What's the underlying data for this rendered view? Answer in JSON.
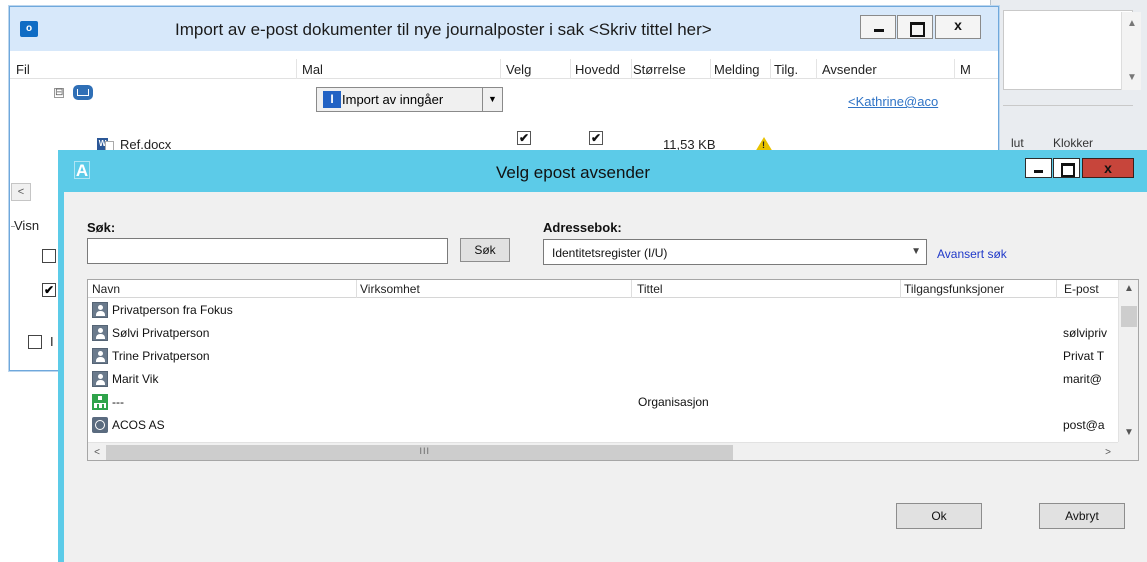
{
  "background_window": {
    "up_arrow": "▲",
    "down_arrow": "▼",
    "header_fragment_1": "lut",
    "header_fragment_2": "Klokker"
  },
  "import_window": {
    "app_icon_text": "o",
    "title": "Import av e-post dokumenter til nye journalposter i sak  <Skriv tittel her>",
    "close_label": "x",
    "columns": [
      "Fil",
      "Mal",
      "Velg",
      "Hovedd",
      "Størrelse",
      "Melding",
      "Tilg.",
      "Avsender",
      "M"
    ],
    "expander_symbol": "⊟",
    "template_dropdown": {
      "icon_text": "I",
      "label": "Import av inngåer",
      "arrow": "▼"
    },
    "sender_link": "<Kathrine@aco",
    "file": {
      "name": "Ref.docx",
      "word_icon_text": "W",
      "velg_checked": "✔",
      "hoveddokument_checked": "✔",
      "size": "11,53 KB",
      "warning_symbol": "!"
    },
    "scroll_left": "<",
    "visning_label": "Visn",
    "check_1": "",
    "check_2": "✔",
    "check_3": "",
    "bottom_label": "I"
  },
  "dialog": {
    "app_icon_text": "A",
    "title": "Velg epost avsender",
    "close_label": "x",
    "search": {
      "label": "Søk:",
      "value": "",
      "button": "Søk"
    },
    "address_book": {
      "label": "Adressebok:",
      "selected": "Identitetsregister (I/U)",
      "arrow": "▼"
    },
    "advanced_search_link": "Avansert søk",
    "columns": [
      "Navn",
      "Virksomhet",
      "Tittel",
      "Tilgangsfunksjoner",
      "E-post"
    ],
    "rows": [
      {
        "icon": "person-icon",
        "name": "Privatperson fra Fokus",
        "tittel": "",
        "epost": ""
      },
      {
        "icon": "person-icon",
        "name": "Sølvi Privatperson",
        "tittel": "",
        "epost": "sølvipriv"
      },
      {
        "icon": "person-icon",
        "name": "Trine Privatperson",
        "tittel": "",
        "epost": "Privat T"
      },
      {
        "icon": "person-icon",
        "name": "Marit Vik",
        "tittel": "",
        "epost": "marit@"
      },
      {
        "icon": "organization-icon",
        "name": "---",
        "tittel": "Organisasjon",
        "epost": ""
      },
      {
        "icon": "globe-icon",
        "name": "ACOS AS",
        "tittel": "",
        "epost": "post@a"
      }
    ],
    "scroll": {
      "up": "▲",
      "down": "▼",
      "left": "<",
      "right": ">",
      "thumb_grip": "III"
    },
    "ok_button": "Ok",
    "cancel_button": "Avbryt"
  }
}
